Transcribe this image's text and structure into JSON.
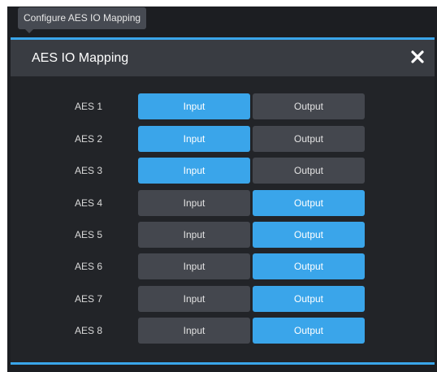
{
  "tooltip": {
    "text": "Configure AES IO Mapping"
  },
  "dialog": {
    "title": "AES IO Mapping",
    "close_icon": "close-icon"
  },
  "colors": {
    "accent": "#3aa5ea",
    "header_bg": "#393c42",
    "body_bg": "#222428",
    "segment_inactive": "#44474e"
  },
  "rows": [
    {
      "label": "AES 1",
      "input_label": "Input",
      "output_label": "Output",
      "selected": "input"
    },
    {
      "label": "AES 2",
      "input_label": "Input",
      "output_label": "Output",
      "selected": "input"
    },
    {
      "label": "AES 3",
      "input_label": "Input",
      "output_label": "Output",
      "selected": "input"
    },
    {
      "label": "AES 4",
      "input_label": "Input",
      "output_label": "Output",
      "selected": "output"
    },
    {
      "label": "AES 5",
      "input_label": "Input",
      "output_label": "Output",
      "selected": "output"
    },
    {
      "label": "AES 6",
      "input_label": "Input",
      "output_label": "Output",
      "selected": "output"
    },
    {
      "label": "AES 7",
      "input_label": "Input",
      "output_label": "Output",
      "selected": "output"
    },
    {
      "label": "AES 8",
      "input_label": "Input",
      "output_label": "Output",
      "selected": "output"
    }
  ]
}
